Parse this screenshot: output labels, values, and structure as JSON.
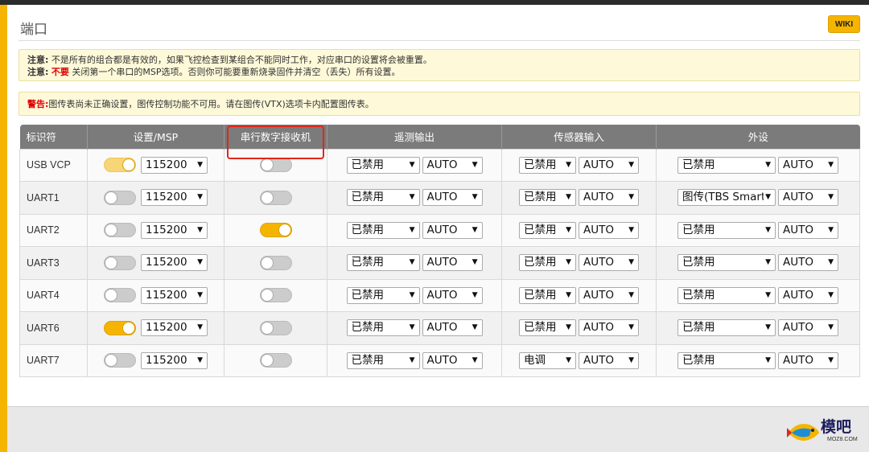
{
  "page": {
    "title": "端口",
    "wiki_label": "WIKI"
  },
  "notes": {
    "line1_label": "注意:",
    "line1_text": "不是所有的组合都是有效的，如果飞控检查到某组合不能同时工作，对应串口的设置将会被重置。",
    "line2_label": "注意:",
    "line2_red": "不要",
    "line2_text": "关闭第一个串口的MSP选项。否则你可能要重新烧录固件并清空（丢失）所有设置。",
    "warning_label": "警告:",
    "warning_text": "图传表尚未正确设置，图传控制功能不可用。请在图传(VTX)选项卡内配置图传表。"
  },
  "table": {
    "headers": [
      "标识符",
      "设置/MSP",
      "串行数字接收机",
      "遥测输出",
      "传感器输入",
      "外设"
    ],
    "rows": [
      {
        "id": "USB VCP",
        "msp_on": true,
        "msp_pale": true,
        "baud": "115200",
        "serial_rx": false,
        "telemetry": "已禁用",
        "telemetry_baud": "AUTO",
        "sensor": "已禁用",
        "sensor_baud": "AUTO",
        "peripheral": "已禁用",
        "peripheral_baud": "AUTO"
      },
      {
        "id": "UART1",
        "msp_on": false,
        "baud": "115200",
        "serial_rx": false,
        "telemetry": "已禁用",
        "telemetry_baud": "AUTO",
        "sensor": "已禁用",
        "sensor_baud": "AUTO",
        "peripheral": "图传(TBS SmartAudio)",
        "peripheral_baud": "AUTO"
      },
      {
        "id": "UART2",
        "msp_on": false,
        "baud": "115200",
        "serial_rx": true,
        "telemetry": "已禁用",
        "telemetry_baud": "AUTO",
        "sensor": "已禁用",
        "sensor_baud": "AUTO",
        "peripheral": "已禁用",
        "peripheral_baud": "AUTO"
      },
      {
        "id": "UART3",
        "msp_on": false,
        "baud": "115200",
        "serial_rx": false,
        "telemetry": "已禁用",
        "telemetry_baud": "AUTO",
        "sensor": "已禁用",
        "sensor_baud": "AUTO",
        "peripheral": "已禁用",
        "peripheral_baud": "AUTO"
      },
      {
        "id": "UART4",
        "msp_on": false,
        "baud": "115200",
        "serial_rx": false,
        "telemetry": "已禁用",
        "telemetry_baud": "AUTO",
        "sensor": "已禁用",
        "sensor_baud": "AUTO",
        "peripheral": "已禁用",
        "peripheral_baud": "AUTO"
      },
      {
        "id": "UART6",
        "msp_on": true,
        "baud": "115200",
        "serial_rx": false,
        "telemetry": "已禁用",
        "telemetry_baud": "AUTO",
        "sensor": "已禁用",
        "sensor_baud": "AUTO",
        "peripheral": "已禁用",
        "peripheral_baud": "AUTO"
      },
      {
        "id": "UART7",
        "msp_on": false,
        "baud": "115200",
        "serial_rx": false,
        "telemetry": "已禁用",
        "telemetry_baud": "AUTO",
        "sensor": "电调",
        "sensor_baud": "AUTO",
        "peripheral": "已禁用",
        "peripheral_baud": "AUTO"
      }
    ]
  },
  "watermark": {
    "main": "模吧",
    "sub": "MOZ8.COM"
  },
  "colors": {
    "accent": "#f5b400",
    "highlight": "#e0261b",
    "header_bg": "#7b7b7b"
  }
}
